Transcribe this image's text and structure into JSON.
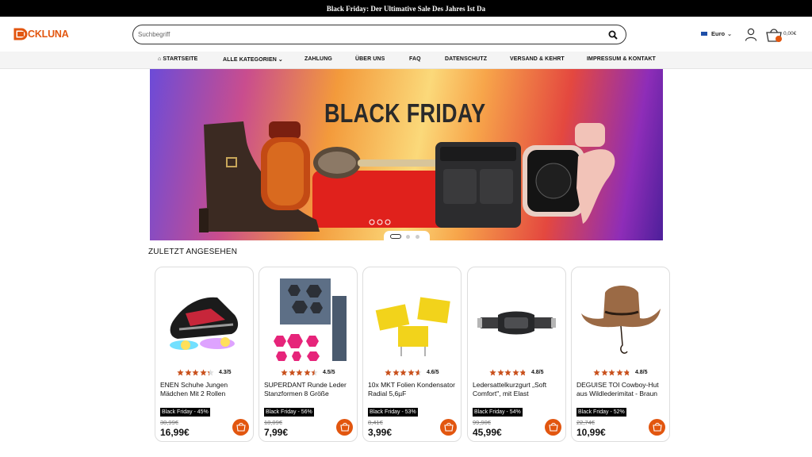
{
  "announcement": "Black Friday: Der Ultimative Sale Des Jahres Ist Da",
  "header": {
    "logo_text": "CKLUNA",
    "search_placeholder": "Suchbegriff",
    "currency": "Euro",
    "cart_total": "0,00€"
  },
  "nav": [
    {
      "label": "STARTSEITE",
      "icon": "home-icon"
    },
    {
      "label": "ALLE KATEGORIEN",
      "has_dropdown": true
    },
    {
      "label": "ZAHLUNG"
    },
    {
      "label": "ÜBER UNS"
    },
    {
      "label": "FAQ"
    },
    {
      "label": "DATENSCHUTZ"
    },
    {
      "label": "VERSAND & KEHRT"
    },
    {
      "label": "IMPRESSUM & KONTAKT"
    }
  ],
  "hero": {
    "title": "BLACK FRIDAY",
    "slide_count": 3,
    "active_slide": 1
  },
  "recent": {
    "title": "ZULETZT ANGESEHEN",
    "products": [
      {
        "name": "ENEN Schuhe Jungen Mädchen Mit 2 Rollen",
        "rating": 4.3,
        "rating_text": "4.3/5",
        "badge": "Black Friday - 45%",
        "old_price": "30,99€",
        "price": "16,99€",
        "image": "roller-shoe"
      },
      {
        "name": "SUPERDANT Runde Leder Stanzformen 8 Größe",
        "rating": 4.5,
        "rating_text": "4.5/5",
        "badge": "Black Friday - 56%",
        "old_price": "18,09€",
        "price": "7,99€",
        "image": "hexagon-dies"
      },
      {
        "name": "10x MKT Folien Kondensator Radial 5,6µF",
        "rating": 4.6,
        "rating_text": "4.6/5",
        "badge": "Black Friday - 53%",
        "old_price": "8,41€",
        "price": "3,99€",
        "image": "capacitors"
      },
      {
        "name": "Ledersattelkurzgurt „Soft Comfort\", mit Elast",
        "rating": 4.8,
        "rating_text": "4.8/5",
        "badge": "Black Friday - 54%",
        "old_price": "99,90€",
        "price": "45,99€",
        "image": "saddle-girth"
      },
      {
        "name": "DEGUISE TOI Cowboy-Hut aus Wildlederimitat - Braun",
        "rating": 4.8,
        "rating_text": "4.8/5",
        "badge": "Black Friday - 52%",
        "old_price": "22,74€",
        "price": "10,99€",
        "image": "cowboy-hat"
      }
    ]
  },
  "colors": {
    "accent": "#e2560f",
    "star": "#c9501c",
    "topbar": "#000000"
  }
}
